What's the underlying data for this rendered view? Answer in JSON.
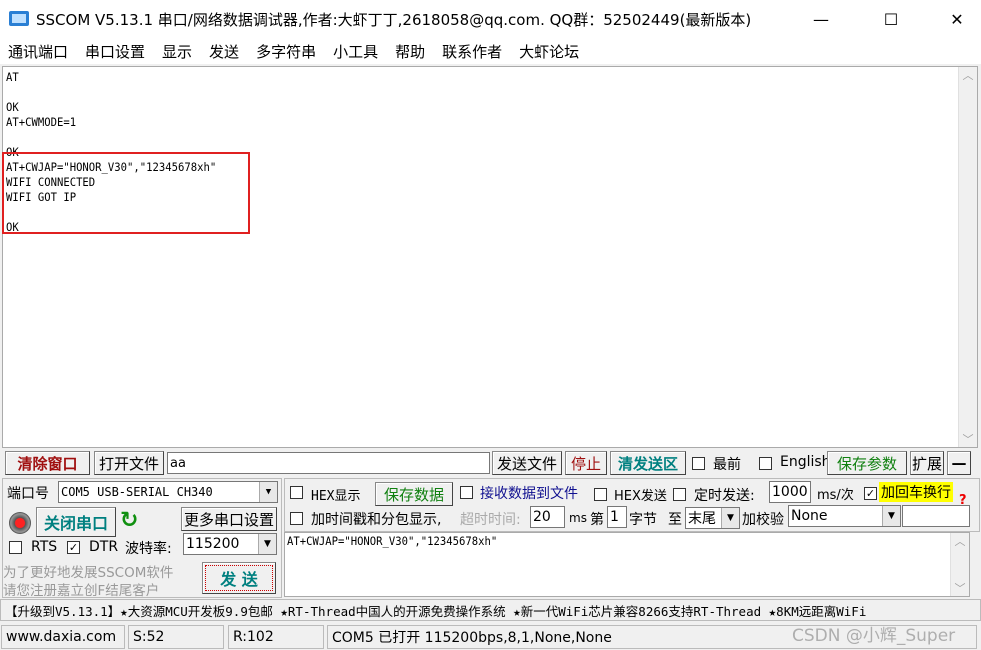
{
  "window": {
    "title": "SSCOM V5.13.1 串口/网络数据调试器,作者:大虾丁丁,2618058@qq.com. QQ群：52502449(最新版本)",
    "minimize": "—",
    "maximize": "☐",
    "close": "✕"
  },
  "menu": [
    "通讯端口",
    "串口设置",
    "显示",
    "发送",
    "多字符串",
    "小工具",
    "帮助",
    "联系作者",
    "大虾论坛"
  ],
  "receive": {
    "lines": "AT\n\nOK\nAT+CWMODE=1\n\nOK\nAT+CWJAP=\"HONOR_V30\",\"12345678xh\"\nWIFI CONNECTED\nWIFI GOT IP\n\nOK"
  },
  "toolbar": {
    "clear": "清除窗口",
    "open_file": "打开文件",
    "file_path": "aa",
    "send_file": "发送文件",
    "stop": "停止",
    "clear_send": "清发送区",
    "topmost": "最前",
    "english": "English",
    "save_params": "保存参数",
    "expand": "扩展",
    "collapse": "—"
  },
  "port": {
    "label": "端口号",
    "value": "COM5 USB-SERIAL CH340",
    "close_port": "关闭串口",
    "more_settings": "更多串口设置",
    "rts": "RTS",
    "dtr": "DTR",
    "dtr_checked": true,
    "rts_checked": false,
    "baud_label": "波特率:",
    "baud": "115200",
    "promo1": "为了更好地发展SSCOM软件",
    "promo2": "请您注册嘉立创F结尾客户",
    "send": "发  送"
  },
  "options": {
    "hex_display": "HEX显示",
    "save_data": "保存数据",
    "recv_to_file": "接收数据到文件",
    "hex_send": "HEX发送",
    "timed_send": "定时发送:",
    "interval": "1000",
    "interval_unit": "ms/次",
    "add_crlf": "加回车换行",
    "add_crlf_checked": true,
    "timestamp": "加时间戳和分包显示,",
    "timeout_label": "超时时间:",
    "timeout": "20",
    "timeout_unit": "ms",
    "byte_from_label": "第",
    "byte_from": "1",
    "byte_unit": "字节",
    "to_label": "至",
    "to_value": "末尾",
    "checksum_label": "加校验",
    "checksum": "None",
    "help": "?"
  },
  "send_text": "AT+CWJAP=\"HONOR_V30\",\"12345678xh\"",
  "ticker": "【升级到V5.13.1】★大资源MCU开发板9.9包邮 ★RT-Thread中国人的开源免费操作系统 ★新一代WiFi芯片兼容8266支持RT-Thread ★8KM远距离WiFi",
  "statusbar": {
    "site": "www.daxia.com",
    "sent": "S:52",
    "received": "R:102",
    "port_status": "COM5 已打开  115200bps,8,1,None,None"
  },
  "watermark": "CSDN @小辉_Super",
  "colors": {
    "red_highlight": "#e02020",
    "clear_btn": "#a01010",
    "close_port": "#008080",
    "yellow": "#ffff00"
  }
}
